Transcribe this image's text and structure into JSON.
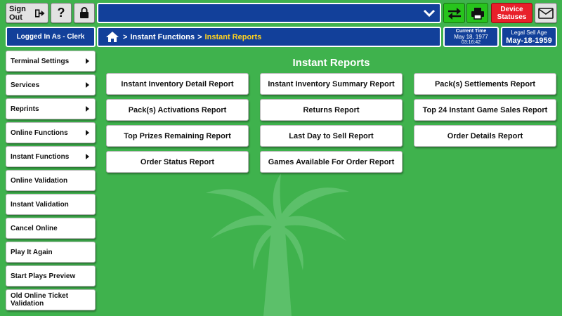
{
  "topbar": {
    "sign_out_label": "Sign Out",
    "help_label": "?",
    "device_statuses_line1": "Device",
    "device_statuses_line2": "Statuses"
  },
  "header": {
    "logged_in_label": "Logged In As - Clerk",
    "breadcrumb": {
      "item1": "Instant Functions",
      "separator": ">",
      "item2": "Instant Reports"
    },
    "current_time_label": "Current Time",
    "current_date": "May 18, 1977",
    "current_time": "03:16:42",
    "legal_age_label": "Legal Sell Age",
    "legal_age_date": "May-18-1959"
  },
  "sidebar": {
    "items": [
      {
        "label": "Terminal Settings",
        "has_submenu": true
      },
      {
        "label": "Services",
        "has_submenu": true
      },
      {
        "label": "Reprints",
        "has_submenu": true
      },
      {
        "label": "Online Functions",
        "has_submenu": true
      },
      {
        "label": "Instant Functions",
        "has_submenu": true
      },
      {
        "label": "Online Validation",
        "has_submenu": false
      },
      {
        "label": "Instant Validation",
        "has_submenu": false
      },
      {
        "label": "Cancel Online",
        "has_submenu": false
      },
      {
        "label": "Play It Again",
        "has_submenu": false
      },
      {
        "label": "Start Plays Preview",
        "has_submenu": false
      },
      {
        "label": "Old Online Ticket Validation",
        "has_submenu": false
      }
    ]
  },
  "main": {
    "title": "Instant Reports",
    "reports": [
      "Instant Inventory Detail Report",
      "Instant Inventory Summary Report",
      "Pack(s) Settlements Report",
      "Pack(s) Activations Report",
      "Returns Report",
      "Top 24 Instant Game Sales Report",
      "Top Prizes Remaining Report",
      "Last Day to Sell Report",
      "Order Details Report",
      "Order Status Report",
      "Games Available For Order Report"
    ]
  },
  "colors": {
    "background": "#3fb24d",
    "header_blue": "#12409a",
    "accent_green": "#27c41c",
    "alert_red": "#e8202a",
    "breadcrumb_current": "#ffd21f"
  },
  "icons": [
    "sign-out-icon",
    "lock-icon",
    "chevron-down-icon",
    "swap-arrows-icon",
    "printer-icon",
    "mail-icon",
    "home-icon",
    "palm-tree-watermark"
  ]
}
